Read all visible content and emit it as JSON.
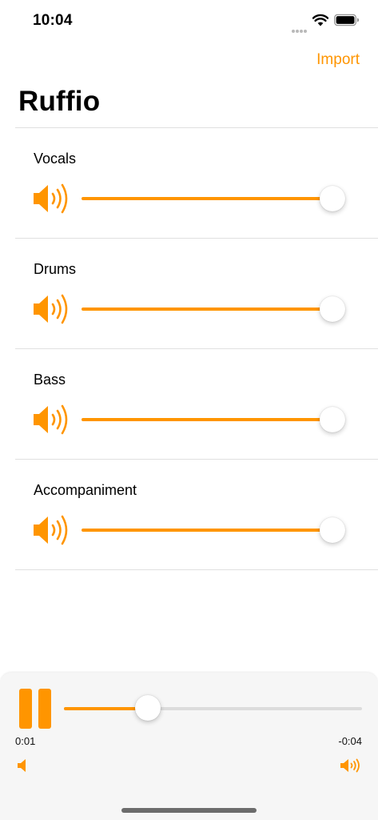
{
  "status_bar": {
    "time": "10:04",
    "icons": [
      "signal-dots-icon",
      "wifi-icon",
      "battery-icon"
    ]
  },
  "nav": {
    "import_label": "Import",
    "title": "Ruffio"
  },
  "tracks": [
    {
      "label": "Vocals",
      "volume": 1.0,
      "icon": "speaker-loud-icon"
    },
    {
      "label": "Drums",
      "volume": 1.0,
      "icon": "speaker-loud-icon"
    },
    {
      "label": "Bass",
      "volume": 1.0,
      "icon": "speaker-loud-icon"
    },
    {
      "label": "Accompaniment",
      "volume": 1.0,
      "icon": "speaker-loud-icon"
    }
  ],
  "player": {
    "state_icon": "pause-icon",
    "elapsed": "0:01",
    "remaining": "-0:04",
    "progress": 0.26,
    "volume_min_icon": "speaker-min-icon",
    "volume_max_icon": "speaker-max-icon"
  },
  "colors": {
    "accent": "#ff9500",
    "track_inactive": "#dcdcdc",
    "panel_background": "#f6f6f6",
    "divider": "#e0e0e0"
  }
}
